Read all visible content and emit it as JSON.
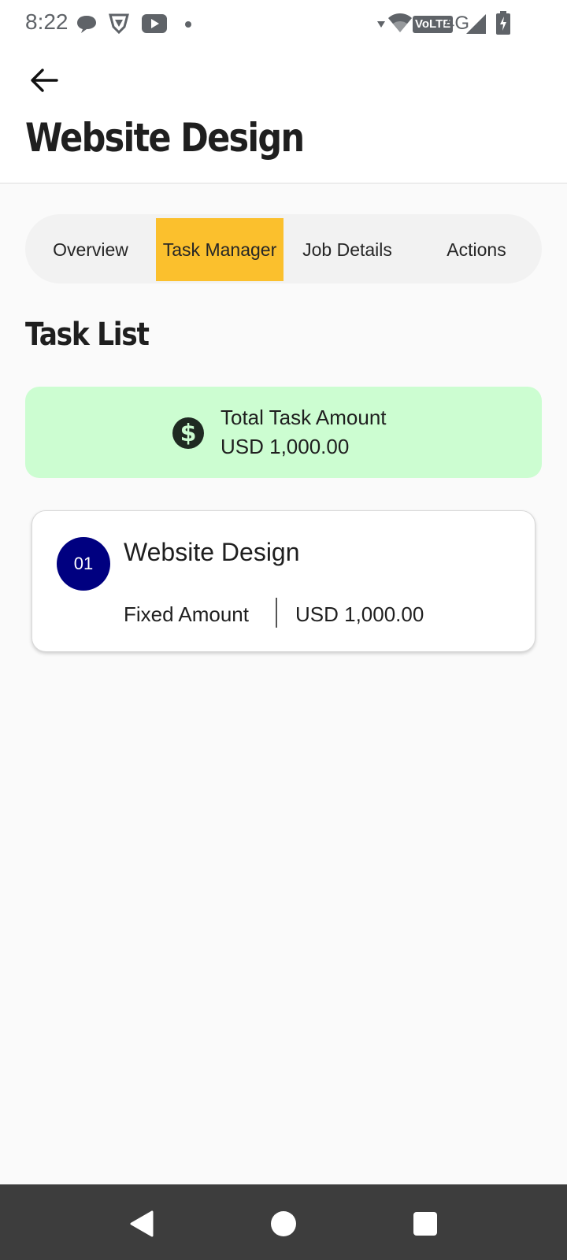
{
  "status_bar": {
    "time": "8:22",
    "left_icons": [
      "chat-bubble-icon",
      "shield-icon",
      "youtube-icon",
      "dot-icon"
    ],
    "right_icons": [
      "wifi-icon",
      "volte-icon",
      "4g-icon",
      "signal-icon",
      "battery-icon"
    ],
    "volte_label": "VoLTE",
    "network_label": "4G"
  },
  "header": {
    "title": "Website Design",
    "back_icon": "arrow-left-icon"
  },
  "tabs": [
    {
      "label": "Overview",
      "active": false
    },
    {
      "label": "Task Manager",
      "active": true
    },
    {
      "label": "Job Details",
      "active": false
    },
    {
      "label": "Actions",
      "active": false
    }
  ],
  "section_title": "Task List",
  "total": {
    "icon": "dollar-circle-icon",
    "label": "Total Task Amount",
    "value": "USD 1,000.00"
  },
  "tasks": [
    {
      "number": "01",
      "title": "Website Design",
      "type": "Fixed Amount",
      "amount": "USD 1,000.00"
    }
  ],
  "nav_bar": {
    "icons": [
      "back-triangle-icon",
      "home-circle-icon",
      "recents-square-icon"
    ]
  },
  "colors": {
    "active_tab": "#fbc02d",
    "total_card": "#ccfdd1",
    "task_badge": "#000080",
    "nav_bar": "#3d3d3d"
  }
}
